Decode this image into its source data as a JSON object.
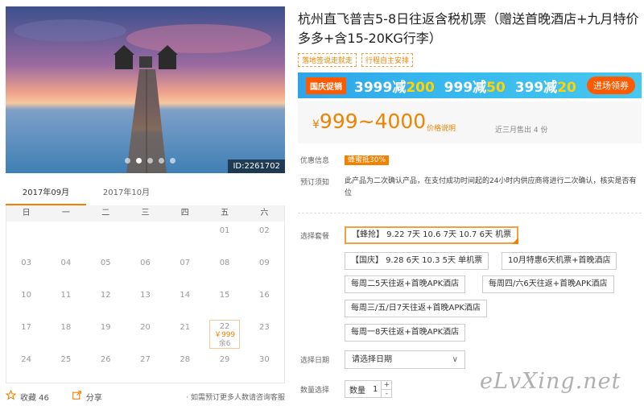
{
  "hero": {
    "product_id": "ID:2261702",
    "slide_count": 5,
    "active_slide": 1
  },
  "calendar": {
    "tabs": [
      "2017年09月",
      "2017年10月"
    ],
    "active_tab": 0,
    "weekdays": [
      "日",
      "一",
      "二",
      "三",
      "四",
      "五",
      "六"
    ],
    "cells": [
      "",
      "",
      "",
      "",
      "",
      "01",
      "02",
      "03",
      "04",
      "05",
      "06",
      "07",
      "08",
      "09",
      "10",
      "11",
      "12",
      "13",
      "14",
      "15",
      "16",
      "17",
      "18",
      "19",
      "20",
      "21",
      "22",
      "23",
      "24",
      "25",
      "26",
      "27",
      "28",
      "29",
      "30"
    ],
    "special": {
      "day": "22",
      "price": "￥999",
      "stock": "余6"
    }
  },
  "footer": {
    "favorite": "收藏 46",
    "share": "分享",
    "note": "· 如需预订更多人数请咨询客服"
  },
  "product": {
    "title": "杭州直飞普吉5-8日往返含税机票（赠送首晚酒店+九月特价多多+含15-20KG行李）",
    "tags": [
      "落地签说走就走",
      "行程自主安排"
    ]
  },
  "banner": {
    "flag": "国庆促销",
    "offers": [
      {
        "base": "3999减",
        "amount": "200"
      },
      {
        "base": "999减",
        "amount": "50"
      },
      {
        "base": "399减",
        "amount": "20"
      }
    ],
    "button": "进场领券"
  },
  "price": {
    "symbol": "¥",
    "range": "999~4000",
    "link": "价格说明",
    "sold": "近三月售出 4 份"
  },
  "discount": {
    "label": "优惠信息",
    "badge": "蜂蜜抵30%"
  },
  "notice": {
    "label": "预订须知",
    "text": "此产品为二次确认产品，在支付成功时间起的24小时内供应商将进行二次确认，核实是否有位"
  },
  "packages": {
    "label": "选择套餐",
    "items": [
      "【蜂抢】 9.22 7天 10.6 7天 10.7 6天 机票",
      "【国庆】 9.28 6天 10.3 5天 单机票",
      "10月特惠6天机票+首晚酒店",
      "每周二5天往返+首晚APK酒店",
      "每周四/六6天往返+首晚APK酒店",
      "每周三/五/日7天往返+首晚APK酒店",
      "每周一8天往返+首晚APK酒店"
    ],
    "selected": 0
  },
  "date": {
    "label": "选择日期",
    "placeholder": "请选择日期"
  },
  "quantity": {
    "label": "数量选择",
    "field_label": "数量",
    "value": "1",
    "plus": "+",
    "minus": "-"
  },
  "watermark": "eLvXing.net",
  "colors": {
    "accent": "#f08200",
    "banner": "#36b7ee",
    "promo_highlight": "#ffd400"
  }
}
